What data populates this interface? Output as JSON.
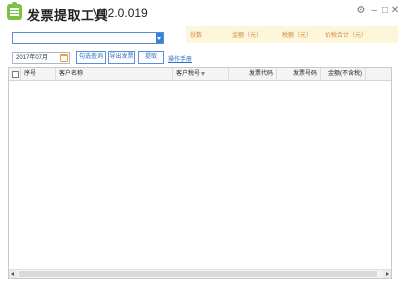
{
  "app": {
    "title": "发票提取工具",
    "version": "V02.0.019"
  },
  "window": {
    "settings_icon": "gear-icon",
    "minimize_icon": "minimize-icon",
    "maximize_icon": "maximize-icon",
    "close_icon": "close-icon"
  },
  "company_select": {
    "value": ""
  },
  "summary": {
    "count_label": "份数",
    "amount_label": "金额（元）",
    "tax_label": "税额（元）",
    "total_label": "价税合计（元）"
  },
  "toolbar": {
    "date_value": "2017年07月",
    "query_label": "勾选查询",
    "export_label": "导出发票",
    "extract_label": "提取",
    "manual_link": "操作手册"
  },
  "table": {
    "columns": [
      "序号",
      "客户名称",
      "客户税号",
      "发票代码",
      "发票号码",
      "金额(不含税)"
    ],
    "rows": []
  },
  "colors": {
    "accent": "#3a7fd8",
    "summary_bg": "#fdf6da",
    "summary_text": "#d08c3c",
    "logo": "#7cc242"
  }
}
